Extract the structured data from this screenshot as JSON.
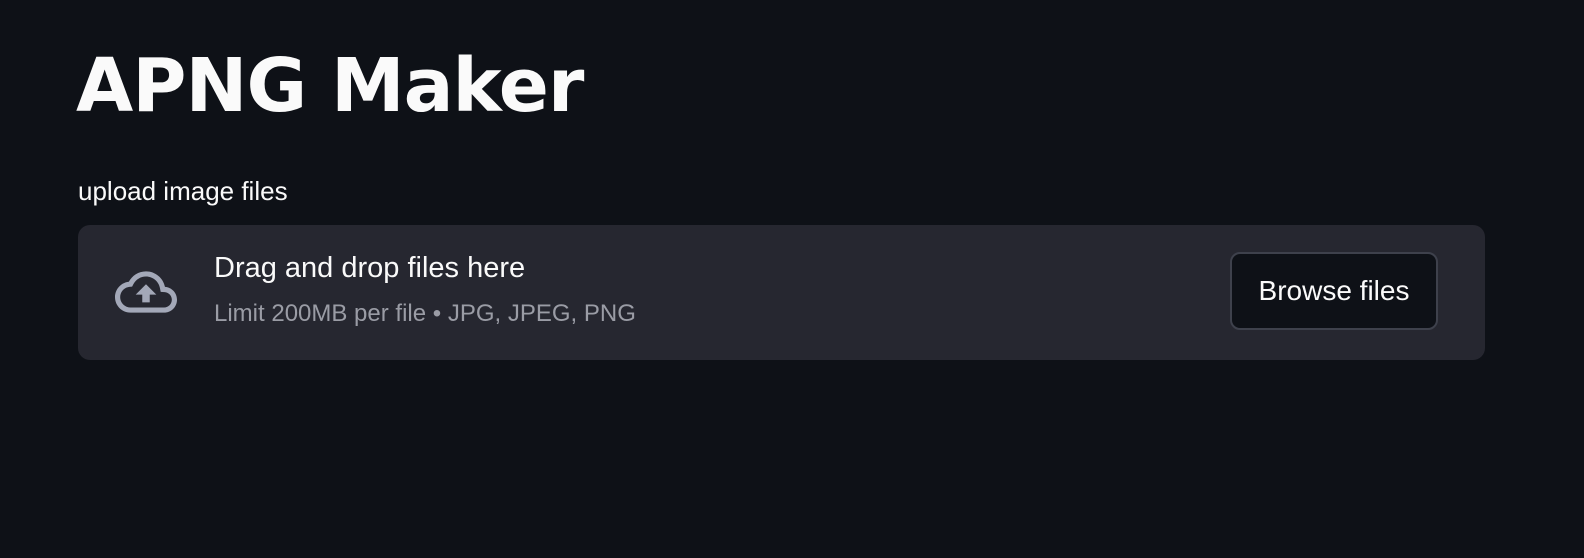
{
  "header": {
    "title": "APNG Maker"
  },
  "uploader": {
    "label": "upload image files",
    "dropzone": {
      "icon": "cloud-upload-icon",
      "primary_text": "Drag and drop files here",
      "secondary_text": "Limit 200MB per file • JPG, JPEG, PNG"
    },
    "browse_label": "Browse files"
  },
  "colors": {
    "background": "#0e1117",
    "dropzone_background": "#262730",
    "text": "#fafafa",
    "muted_text": "#9a9ca5",
    "icon": "#a3a8b8",
    "button_border": "#3e414c"
  }
}
